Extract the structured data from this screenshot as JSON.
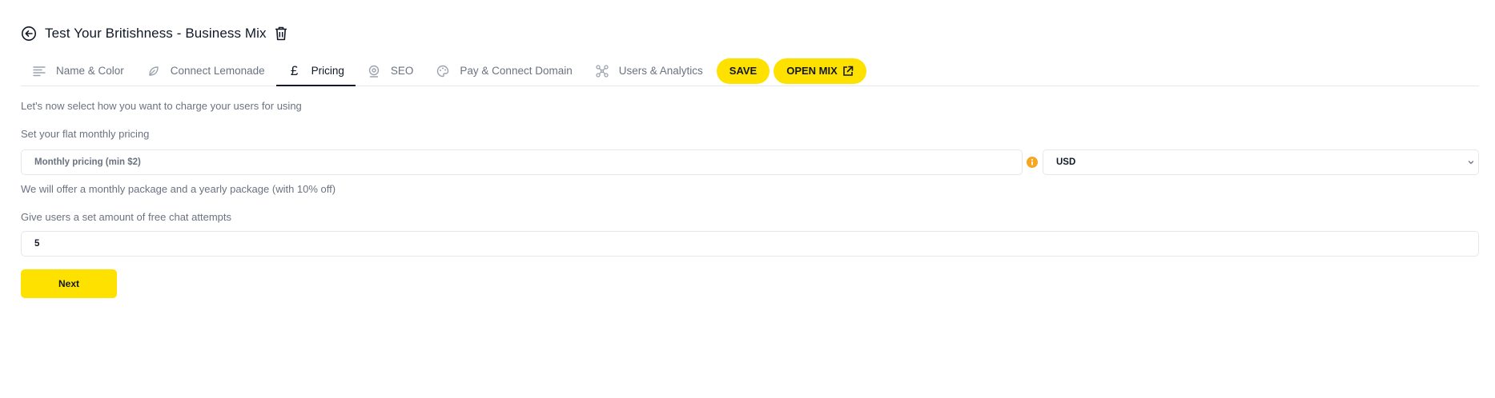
{
  "header": {
    "title": "Test Your Britishness - Business Mix"
  },
  "tabs": [
    {
      "label": "Name & Color",
      "icon": "text-lines-icon",
      "active": false
    },
    {
      "label": "Connect Lemonade",
      "icon": "leaf-icon",
      "active": false
    },
    {
      "label": "Pricing",
      "icon": "pound-icon",
      "active": true
    },
    {
      "label": "SEO",
      "icon": "webcam-icon",
      "active": false
    },
    {
      "label": "Pay & Connect Domain",
      "icon": "palette-icon",
      "active": false
    },
    {
      "label": "Users & Analytics",
      "icon": "network-icon",
      "active": false
    }
  ],
  "actions": {
    "save_label": "SAVE",
    "open_label": "OPEN MIX"
  },
  "form": {
    "intro": "Let's now select how you want to charge your users for using",
    "pricing_label": "Set your flat monthly pricing",
    "pricing_placeholder": "Monthly pricing (min $2)",
    "pricing_value": "",
    "currency": "USD",
    "pricing_note": "We will offer a monthly package and a yearly package (with 10% off)",
    "free_label": "Give users a set amount of free chat attempts",
    "free_value": "5",
    "next_label": "Next"
  },
  "colors": {
    "accent": "#ffe100",
    "info": "#f5a623",
    "muted_text": "#6b7280"
  }
}
